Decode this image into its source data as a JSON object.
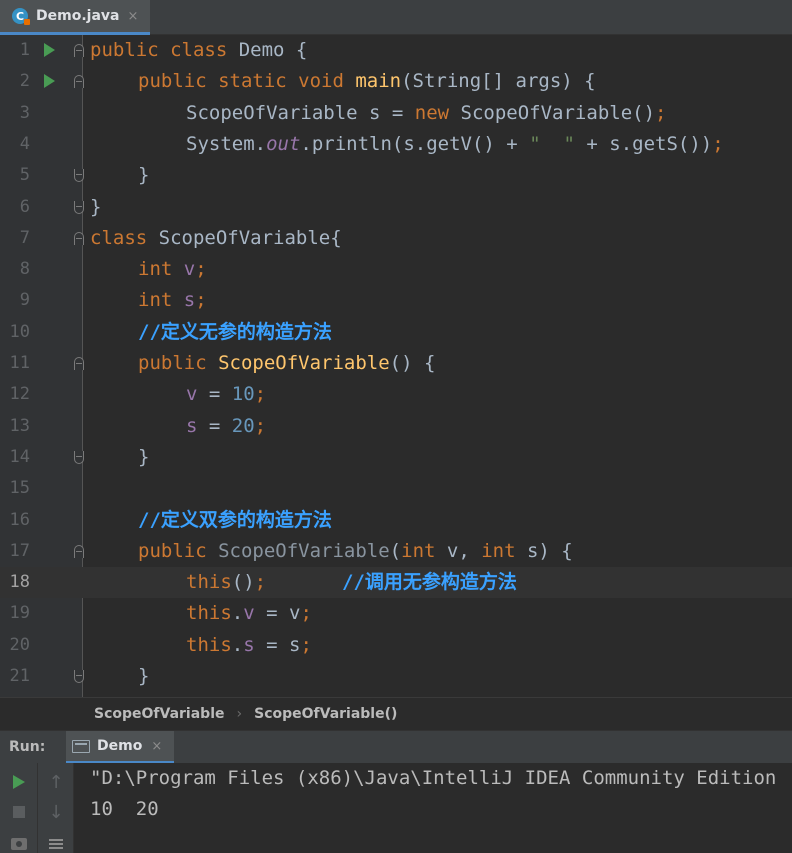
{
  "tab": {
    "label": "Demo.java",
    "close": "×",
    "icon_letter": "C"
  },
  "code_lines": [
    {
      "n": "1"
    },
    {
      "n": "2"
    },
    {
      "n": "3"
    },
    {
      "n": "4"
    },
    {
      "n": "5"
    },
    {
      "n": "6"
    },
    {
      "n": "7"
    },
    {
      "n": "8"
    },
    {
      "n": "9"
    },
    {
      "n": "10"
    },
    {
      "n": "11"
    },
    {
      "n": "12"
    },
    {
      "n": "13"
    },
    {
      "n": "14"
    },
    {
      "n": "15"
    },
    {
      "n": "16"
    },
    {
      "n": "17"
    },
    {
      "n": "18"
    },
    {
      "n": "19"
    },
    {
      "n": "20"
    },
    {
      "n": "21"
    }
  ],
  "tokens": {
    "l1_kw": "public class ",
    "l1_name": "Demo {",
    "l2_kw": "public static void ",
    "l2_fn": "main",
    "l2_rest": "(String[] args) {",
    "l3_a": "ScopeOfVariable s = ",
    "l3_kw": "new ",
    "l3_b": "ScopeOfVariable()",
    "l3_semi": ";",
    "l4_a": "System.",
    "l4_out": "out",
    "l4_b": ".println(s.getV() + ",
    "l4_str": "\"  \"",
    "l4_c": " + s.getS())",
    "l4_semi": ";",
    "l5": "}",
    "l6": "}",
    "l7_kw": "class ",
    "l7_name": "ScopeOfVariable{",
    "l8_kw": "int ",
    "l8_f": "v",
    "l8_semi": ";",
    "l9_kw": "int ",
    "l9_f": "s",
    "l9_semi": ";",
    "l10_cm": "//定义无参的构造方法",
    "l11_kw": "public ",
    "l11_fn": "ScopeOfVariable",
    "l11_rest": "() {",
    "l12_f": "v",
    "l12_eq": " = ",
    "l12_num": "10",
    "l12_semi": ";",
    "l13_f": "s",
    "l13_eq": " = ",
    "l13_num": "20",
    "l13_semi": ";",
    "l14": "}",
    "l16_cm": "//定义双参的构造方法",
    "l17_kw": "public ",
    "l17_name": "ScopeOfVariable",
    "l17_a": "(",
    "l17_kw2": "int ",
    "l17_b": "v, ",
    "l17_kw3": "int ",
    "l17_c": "s) {",
    "l18_kw": "this",
    "l18_a": "()",
    "l18_semi": ";",
    "l18_cm": "//调用无参构造方法",
    "l19_kw": "this",
    "l19_dot": ".",
    "l19_f": "v",
    "l19_a": " = v",
    "l19_semi": ";",
    "l20_kw": "this",
    "l20_dot": ".",
    "l20_f": "s",
    "l20_a": " = s",
    "l20_semi": ";",
    "l21": "}"
  },
  "breadcrumb": {
    "item1": "ScopeOfVariable",
    "sep": "›",
    "item2": "ScopeOfVariable()"
  },
  "run_panel": {
    "title": "Run:",
    "tab_label": "Demo",
    "tab_close": "×",
    "output": [
      "\"D:\\Program Files (x86)\\Java\\IntelliJ IDEA Community Edition",
      "10  20"
    ],
    "up_arrow": "↑",
    "down_arrow": "↓"
  },
  "colors": {
    "background": "#2b2b2b",
    "keyword": "#cc7832",
    "function": "#ffc66d",
    "number": "#6897bb",
    "field": "#9876aa",
    "comment": "#3aa1ff",
    "accent": "#4a88c7",
    "run_green": "#499c54"
  }
}
